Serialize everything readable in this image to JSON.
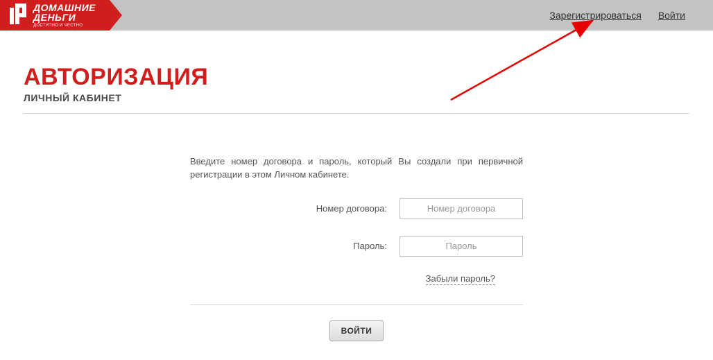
{
  "logo": {
    "line1": "ДОМАШНИЕ",
    "line2": "ДЕНЬГИ",
    "line3": "ДОСТУПНО И ЧЕСТНО"
  },
  "header": {
    "register": "Зарегистрироваться",
    "login": "Войти"
  },
  "page": {
    "title": "АВТОРИЗАЦИЯ",
    "subtitle": "ЛИЧНЫЙ КАБИНЕТ",
    "intro": "Введите номер договора и пароль, который Вы создали при первичной регистрации в этом Личном кабинете."
  },
  "form": {
    "contract_label": "Номер договора:",
    "contract_placeholder": "Номер договора",
    "password_label": "Пароль:",
    "password_placeholder": "Пароль",
    "forgot": "Забыли пароль?",
    "submit": "ВОЙТИ"
  }
}
